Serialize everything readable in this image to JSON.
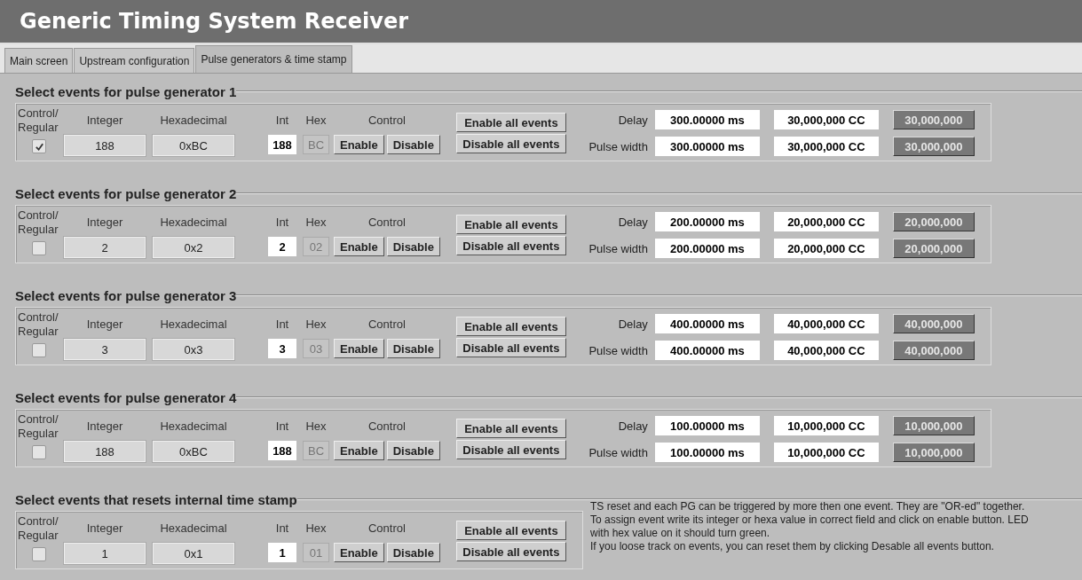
{
  "window": {
    "title": "Generic Timing System Receiver"
  },
  "tabs": [
    {
      "label": "Main screen",
      "selected": false
    },
    {
      "label": "Upstream configuration",
      "selected": false
    },
    {
      "label": "Pulse generators & time stamp",
      "selected": true
    }
  ],
  "sections": [
    {
      "kind": "pulse_generator",
      "title": "Select events for pulse generator 1",
      "headers": {
        "control_regular": "Control/ Regular",
        "integer": "Integer",
        "hexadecimal": "Hexadecimal",
        "int": "Int",
        "hex": "Hex",
        "control": "Control"
      },
      "checked": true,
      "integer": "188",
      "hexadecimal": "0xBC",
      "int": "188",
      "hex": "BC",
      "enable": "Enable",
      "disable": "Disable",
      "enable_all": "Enable all events",
      "disable_all": "Disable all events",
      "timing": [
        {
          "label": "Delay",
          "ms": "300.00000 ms",
          "cc": "30,000,000 CC",
          "counter": "30,000,000"
        },
        {
          "label": "Pulse width",
          "ms": "300.00000 ms",
          "cc": "30,000,000 CC",
          "counter": "30,000,000"
        }
      ]
    },
    {
      "kind": "pulse_generator",
      "title": "Select events for pulse generator 2",
      "headers": {
        "control_regular": "Control/ Regular",
        "integer": "Integer",
        "hexadecimal": "Hexadecimal",
        "int": "Int",
        "hex": "Hex",
        "control": "Control"
      },
      "checked": false,
      "integer": "2",
      "hexadecimal": "0x2",
      "int": "2",
      "hex": "02",
      "enable": "Enable",
      "disable": "Disable",
      "enable_all": "Enable all events",
      "disable_all": "Disable all events",
      "timing": [
        {
          "label": "Delay",
          "ms": "200.00000 ms",
          "cc": "20,000,000 CC",
          "counter": "20,000,000"
        },
        {
          "label": "Pulse width",
          "ms": "200.00000 ms",
          "cc": "20,000,000 CC",
          "counter": "20,000,000"
        }
      ]
    },
    {
      "kind": "pulse_generator",
      "title": "Select events for pulse generator 3",
      "headers": {
        "control_regular": "Control/ Regular",
        "integer": "Integer",
        "hexadecimal": "Hexadecimal",
        "int": "Int",
        "hex": "Hex",
        "control": "Control"
      },
      "checked": false,
      "integer": "3",
      "hexadecimal": "0x3",
      "int": "3",
      "hex": "03",
      "enable": "Enable",
      "disable": "Disable",
      "enable_all": "Enable all events",
      "disable_all": "Disable all events",
      "timing": [
        {
          "label": "Delay",
          "ms": "400.00000 ms",
          "cc": "40,000,000 CC",
          "counter": "40,000,000"
        },
        {
          "label": "Pulse width",
          "ms": "400.00000 ms",
          "cc": "40,000,000 CC",
          "counter": "40,000,000"
        }
      ]
    },
    {
      "kind": "pulse_generator",
      "title": "Select events for pulse generator 4",
      "headers": {
        "control_regular": "Control/ Regular",
        "integer": "Integer",
        "hexadecimal": "Hexadecimal",
        "int": "Int",
        "hex": "Hex",
        "control": "Control"
      },
      "checked": false,
      "integer": "188",
      "hexadecimal": "0xBC",
      "int": "188",
      "hex": "BC",
      "enable": "Enable",
      "disable": "Disable",
      "enable_all": "Enable all events",
      "disable_all": "Disable all events",
      "timing": [
        {
          "label": "Delay",
          "ms": "100.00000 ms",
          "cc": "10,000,000 CC",
          "counter": "10,000,000"
        },
        {
          "label": "Pulse width",
          "ms": "100.00000 ms",
          "cc": "10,000,000 CC",
          "counter": "10,000,000"
        }
      ]
    },
    {
      "kind": "timestamp_reset",
      "title": "Select events that resets internal time stamp",
      "headers": {
        "control_regular": "Control/ Regular",
        "integer": "Integer",
        "hexadecimal": "Hexadecimal",
        "int": "Int",
        "hex": "Hex",
        "control": "Control"
      },
      "checked": false,
      "integer": "1",
      "hexadecimal": "0x1",
      "int": "1",
      "hex": "01",
      "enable": "Enable",
      "disable": "Disable",
      "enable_all": "Enable all events",
      "disable_all": "Disable all events",
      "help": [
        "TS reset and each PG can be triggered by more then one event. They are \"OR-ed\" together.",
        "To assign event write its integer or hexa value in correct field and click on enable button. LED with hex value on it should turn green.",
        "If you loose track on events, you can reset them by clicking Desable all events button."
      ]
    }
  ]
}
